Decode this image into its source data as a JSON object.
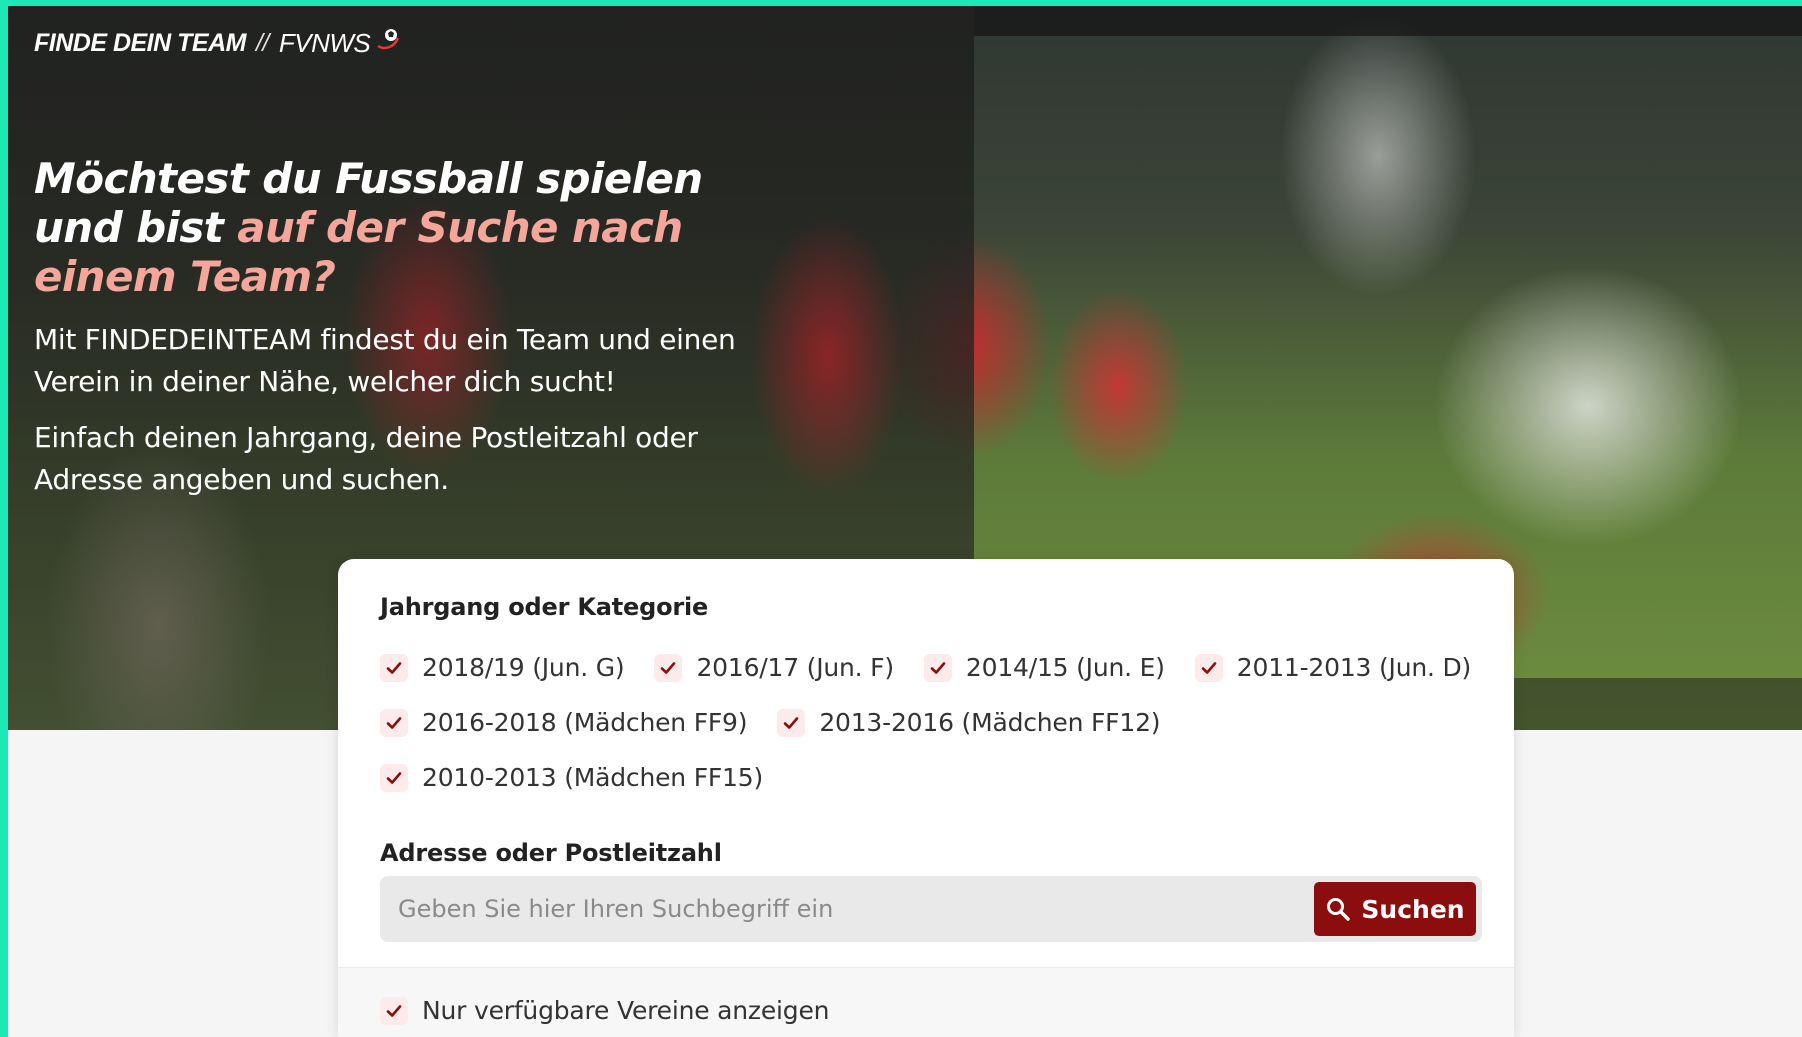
{
  "brand": {
    "title": "FINDE DEIN TEAM",
    "separator": "//",
    "partner": "FVNWS"
  },
  "hero": {
    "headline_part1": "Möchtest du Fussball spielen und bist ",
    "headline_accent": "auf der Suche nach einem Team?",
    "intro_1": "Mit FINDEDEINTEAM findest du ein Team und einen Verein in deiner Nähe, welcher dich sucht!",
    "intro_2": "Einfach deinen Jahrgang, deine Postleitzahl oder Adresse angeben und suchen."
  },
  "filters": {
    "category_label": "Jahrgang oder Kategorie",
    "categories": [
      {
        "label": "2018/19 (Jun. G)",
        "checked": true
      },
      {
        "label": "2016/17 (Jun. F)",
        "checked": true
      },
      {
        "label": "2014/15 (Jun. E)",
        "checked": true
      },
      {
        "label": "2011-2013 (Jun. D)",
        "checked": true
      },
      {
        "label": "2016-2018 (Mädchen FF9)",
        "checked": true
      },
      {
        "label": "2013-2016 (Mädchen FF12)",
        "checked": true
      },
      {
        "label": "2010-2013 (Mädchen FF15)",
        "checked": true
      }
    ],
    "address_label": "Adresse oder Postleitzahl",
    "search_placeholder": "Geben Sie hier Ihren Suchbegriff ein",
    "search_value": "",
    "search_button": "Suchen",
    "available_only": {
      "label": "Nur verfügbare Vereine anzeigen",
      "checked": true
    }
  },
  "colors": {
    "accent": "#8b0d0d",
    "headline_accent": "#f4a69a",
    "checkbox_bg": "#fdeaea",
    "frame": "#1de9b6"
  }
}
